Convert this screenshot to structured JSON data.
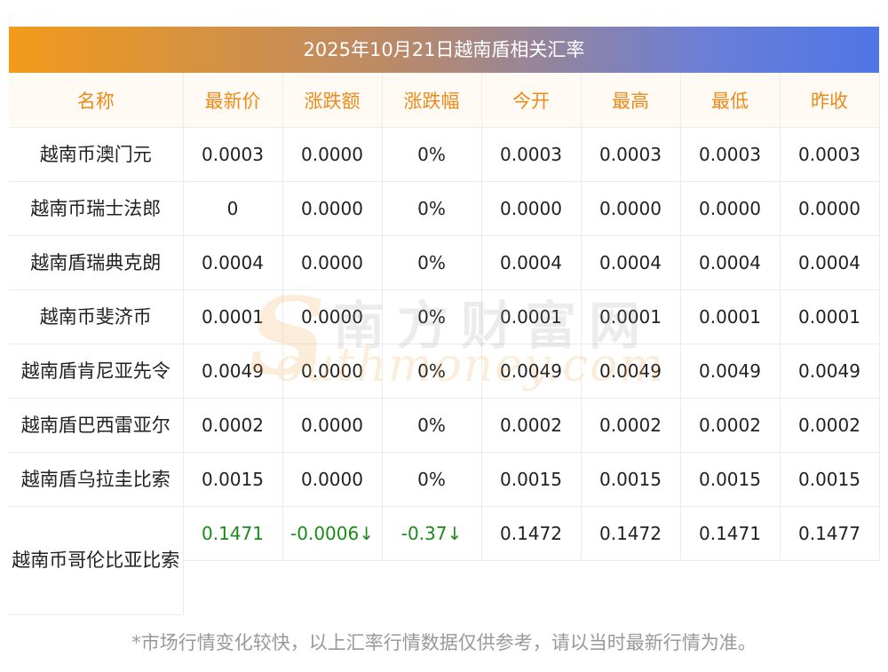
{
  "title": "2025年10月21日越南盾相关汇率",
  "watermark": {
    "cn": "南方财富网",
    "en": "outhmoney.com",
    "s": "S"
  },
  "columns": [
    "名称",
    "最新价",
    "涨跌额",
    "涨跌幅",
    "今开",
    "最高",
    "最低",
    "昨收"
  ],
  "rows": [
    {
      "name": "越南币澳门元",
      "cells": [
        "0.0003",
        "0.0000",
        "0%",
        "0.0003",
        "0.0003",
        "0.0003",
        "0.0003"
      ]
    },
    {
      "name": "越南币瑞士法郎",
      "cells": [
        "0",
        "0.0000",
        "0%",
        "0.0000",
        "0.0000",
        "0.0000",
        "0.0000"
      ]
    },
    {
      "name": "越南盾瑞典克朗",
      "cells": [
        "0.0004",
        "0.0000",
        "0%",
        "0.0004",
        "0.0004",
        "0.0004",
        "0.0004"
      ]
    },
    {
      "name": "越南币斐济币",
      "cells": [
        "0.0001",
        "0.0000",
        "0%",
        "0.0001",
        "0.0001",
        "0.0001",
        "0.0001"
      ]
    },
    {
      "name": "越南盾肯尼亚先令",
      "cells": [
        "0.0049",
        "0.0000",
        "0%",
        "0.0049",
        "0.0049",
        "0.0049",
        "0.0049"
      ]
    },
    {
      "name": "越南盾巴西雷亚尔",
      "cells": [
        "0.0002",
        "0.0000",
        "0%",
        "0.0002",
        "0.0002",
        "0.0002",
        "0.0002"
      ]
    },
    {
      "name": "越南盾乌拉圭比索",
      "cells": [
        "0.0015",
        "0.0000",
        "0%",
        "0.0015",
        "0.0015",
        "0.0015",
        "0.0015"
      ]
    },
    {
      "name": "越南币哥伦比亚比索",
      "cells": [
        "0.1471",
        "-0.0006↓",
        "-0.37↓",
        "0.1472",
        "0.1472",
        "0.1471",
        "0.1477"
      ]
    }
  ],
  "colors": {
    "header_text": "#ee8a1a",
    "down_green": "#1a8a1a",
    "header_bg": "#fffaf3"
  },
  "footnote": "*市场行情变化较快，以上汇率行情数据仅供参考，请以当时最新行情为准。"
}
